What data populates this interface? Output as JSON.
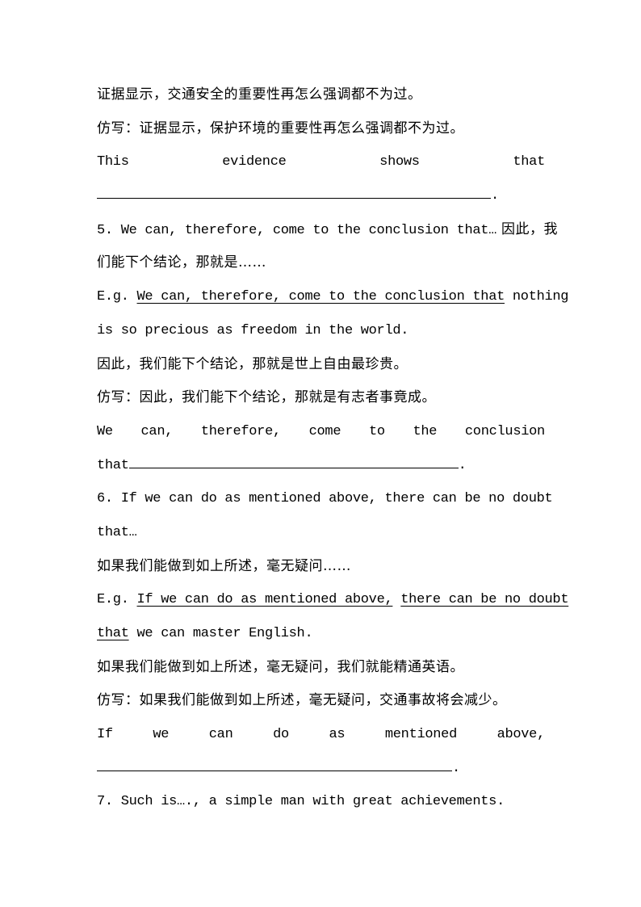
{
  "lines": {
    "l1": "证据显示，交通安全的重要性再怎么强调都不为过。",
    "l2": "仿写：证据显示，保护环境的重要性再怎么强调都不为过。",
    "l3_words": [
      "This",
      "evidence",
      "shows",
      "that"
    ],
    "l4_end": ".",
    "item5": {
      "head_en": "5. We can, therefore, come to the conclusion that…",
      "head_cn": " 因此，我",
      "head_cn2": "们能下个结论，那就是……",
      "eg_prefix": "E.g. ",
      "eg_underlined": "We can, therefore, come to the conclusion that",
      "eg_rest": " nothing",
      "eg_line2": "is so precious as freedom in the world.",
      "translation": "因此，我们能下个结论，那就是世上自由最珍贵。",
      "imitation": "仿写：因此，我们能下个结论，那就是有志者事竟成。",
      "fill_words": [
        "We",
        "can,",
        "therefore,",
        "come",
        "to",
        "the",
        "conclusion"
      ],
      "fill_start": "that",
      "fill_end": "."
    },
    "item6": {
      "head_en": "6. If we can do as mentioned above, there can be no doubt",
      "head_en2": "that…",
      "head_cn": "如果我们能做到如上所述，毫无疑问……",
      "eg_prefix": "E.g. ",
      "eg_underlined1": "If we can do as mentioned above,",
      "eg_underlined2": "there can be no doubt",
      "eg_underlined3": "that",
      "eg_rest": " we can master English.",
      "translation": "如果我们能做到如上所述，毫无疑问，我们就能精通英语。",
      "imitation": "仿写：如果我们能做到如上所述，毫无疑问，交通事故将会减少。",
      "fill_words": [
        "If",
        "we",
        "can",
        "do",
        "as",
        "mentioned",
        "above,"
      ],
      "fill_end": "."
    },
    "item7": {
      "head_en": "7. Such is…., a simple man with great achievements."
    }
  }
}
